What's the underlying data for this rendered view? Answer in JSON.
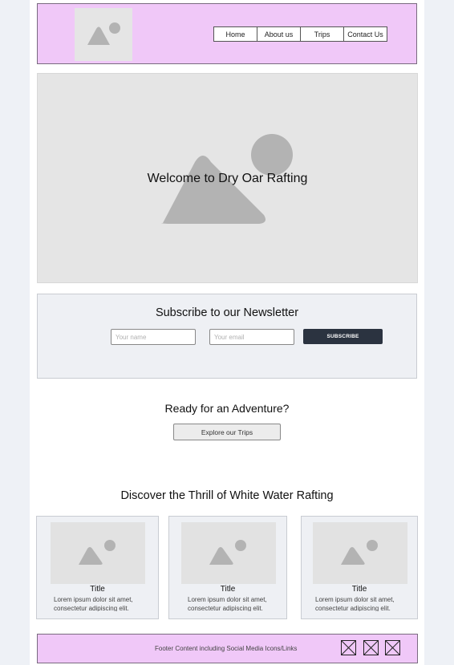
{
  "nav": {
    "items": [
      {
        "label": "Home"
      },
      {
        "label": "About us"
      },
      {
        "label": "Trips"
      },
      {
        "label": "Contact Us"
      }
    ]
  },
  "logo": {
    "icon": "image-placeholder-icon"
  },
  "hero": {
    "title": "Welcome to Dry Oar Rafting",
    "icon": "image-placeholder-icon"
  },
  "newsletter": {
    "title": "Subscribe to our Newsletter",
    "name_placeholder": "Your name",
    "email_placeholder": "Your email",
    "button_label": "SUBSCRIBE"
  },
  "cta": {
    "title": "Ready for an Adventure?",
    "button_label": "Explore our Trips"
  },
  "features": {
    "title": "Discover the Thrill of White Water Rafting",
    "cards": [
      {
        "title": "Title",
        "text": "Lorem ipsum dolor sit amet, consectetur adipiscing elit."
      },
      {
        "title": "Title",
        "text": "Lorem ipsum dolor sit amet, consectetur adipiscing elit."
      },
      {
        "title": "Title",
        "text": "Lorem ipsum dolor sit amet, consectetur adipiscing elit."
      }
    ]
  },
  "footer": {
    "text": "Footer Content including Social Media Icons/Links",
    "social_icons": [
      "social-icon-placeholder",
      "social-icon-placeholder",
      "social-icon-placeholder"
    ]
  },
  "colors": {
    "header_bg": "#f0c8f8",
    "button_dark": "#2b3340",
    "placeholder_gray": "#b0b0b0",
    "page_bg": "#eef1f6"
  }
}
